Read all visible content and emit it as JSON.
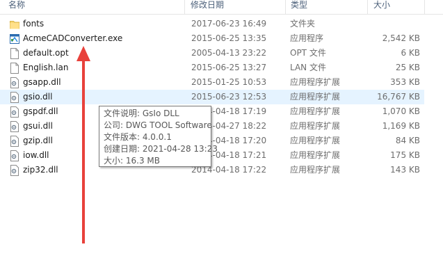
{
  "columns": {
    "name": "名称",
    "date": "修改日期",
    "type": "类型",
    "size": "大小"
  },
  "files": [
    {
      "name": "fonts",
      "date": "2017-06-23 16:49",
      "type": "文件夹",
      "size": "",
      "icon": "folder-icon"
    },
    {
      "name": "AcmeCADConverter.exe",
      "date": "2015-06-25 13:35",
      "type": "应用程序",
      "size": "2,542 KB",
      "icon": "exe-icon"
    },
    {
      "name": "default.opt",
      "date": "2005-04-13 23:22",
      "type": "OPT 文件",
      "size": "6 KB",
      "icon": "file-icon"
    },
    {
      "name": "English.lan",
      "date": "2015-06-25 13:27",
      "type": "LAN 文件",
      "size": "25 KB",
      "icon": "file-icon"
    },
    {
      "name": "gsapp.dll",
      "date": "2015-01-25 10:53",
      "type": "应用程序扩展",
      "size": "353 KB",
      "icon": "dll-icon"
    },
    {
      "name": "gsio.dll",
      "date": "2015-06-23 12:53",
      "type": "应用程序扩展",
      "size": "16,767 KB",
      "icon": "dll-icon"
    },
    {
      "name": "gspdf.dll",
      "date": "2014-04-18 17:19",
      "type": "应用程序扩展",
      "size": "1,070 KB",
      "icon": "dll-icon"
    },
    {
      "name": "gsui.dll",
      "date": "2014-04-27 18:22",
      "type": "应用程序扩展",
      "size": "1,169 KB",
      "icon": "dll-icon"
    },
    {
      "name": "gzip.dll",
      "date": "2014-04-18 17:20",
      "type": "应用程序扩展",
      "size": "84 KB",
      "icon": "dll-icon"
    },
    {
      "name": "iow.dll",
      "date": "2014-04-18 17:21",
      "type": "应用程序扩展",
      "size": "175 KB",
      "icon": "dll-icon"
    },
    {
      "name": "zip32.dll",
      "date": "2014-04-18 17:22",
      "type": "应用程序扩展",
      "size": "143 KB",
      "icon": "dll-icon"
    }
  ],
  "tooltip": {
    "description": "文件说明: GsIo DLL",
    "company": "公司: DWG TOOL Software",
    "version": "文件版本: 4.0.0.1",
    "created": "创建日期: 2021-04-28 13:23",
    "size": "大小: 16.3 MB"
  },
  "colors": {
    "selection": "#cce8ff",
    "arrow": "#e8413b"
  }
}
